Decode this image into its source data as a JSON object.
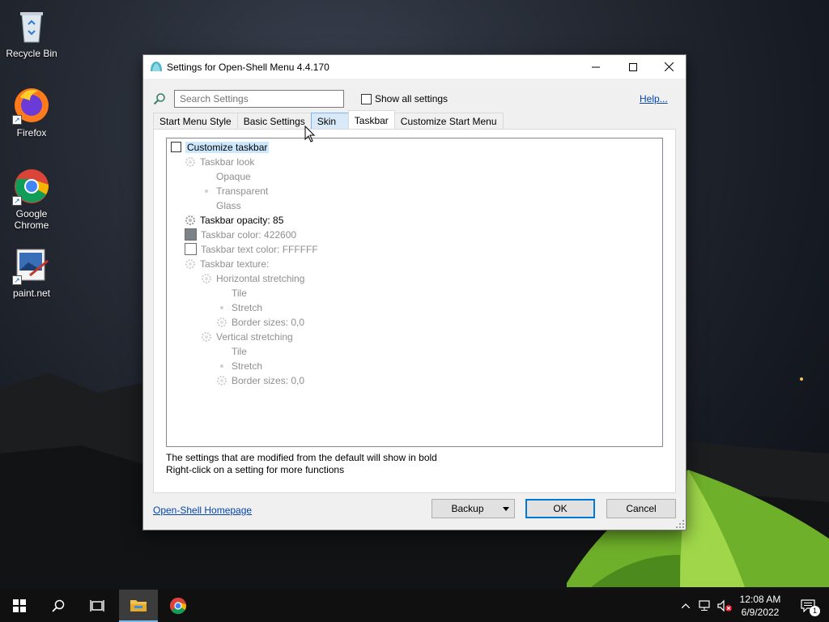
{
  "desktop": {
    "icons": [
      {
        "label": "Recycle Bin",
        "icon": "recycle-bin-icon"
      },
      {
        "label": "Firefox",
        "icon": "firefox-icon"
      },
      {
        "label": "Google Chrome",
        "icon": "chrome-icon"
      },
      {
        "label": "paint.net",
        "icon": "paintnet-icon"
      }
    ]
  },
  "window": {
    "title": "Settings for Open-Shell Menu 4.4.170",
    "search_placeholder": "Search Settings",
    "show_all_label": "Show all settings",
    "help_label": "Help...",
    "tabs": [
      {
        "label": "Start Menu Style",
        "state": "normal"
      },
      {
        "label": "Basic Settings",
        "state": "normal"
      },
      {
        "label": "Skin",
        "state": "hover"
      },
      {
        "label": "Taskbar",
        "state": "active"
      },
      {
        "label": "Customize Start Menu",
        "state": "normal"
      }
    ],
    "tree": [
      {
        "label": "Customize taskbar",
        "kind": "checkbox",
        "checked": false,
        "selected": true
      },
      {
        "label": "Taskbar look",
        "kind": "gear",
        "disabled": true
      },
      {
        "label": "Opaque",
        "kind": "none",
        "disabled": true
      },
      {
        "label": "Transparent",
        "kind": "radio-dot",
        "disabled": true
      },
      {
        "label": "Glass",
        "kind": "none",
        "disabled": true
      },
      {
        "label": "Taskbar opacity: 85",
        "kind": "gear",
        "bold": true
      },
      {
        "label": "Taskbar color: 422600",
        "kind": "swatch",
        "swatch_color": "#7b8288",
        "disabled": true
      },
      {
        "label": "Taskbar text color: FFFFFF",
        "kind": "swatch",
        "swatch_color": "#FFFFFF",
        "disabled": true
      },
      {
        "label": "Taskbar texture:",
        "kind": "gear",
        "disabled": true
      },
      {
        "label": "Horizontal stretching",
        "kind": "gear",
        "disabled": true
      },
      {
        "label": "Tile",
        "kind": "none",
        "disabled": true
      },
      {
        "label": "Stretch",
        "kind": "radio-dot",
        "disabled": true
      },
      {
        "label": "Border sizes: 0,0",
        "kind": "gear",
        "disabled": true
      },
      {
        "label": "Vertical stretching",
        "kind": "gear",
        "disabled": true
      },
      {
        "label": "Tile",
        "kind": "none",
        "disabled": true
      },
      {
        "label": "Stretch",
        "kind": "radio-dot",
        "disabled": true
      },
      {
        "label": "Border sizes: 0,0",
        "kind": "gear",
        "disabled": true
      }
    ],
    "hint_line1": "The settings that are modified from the default will show in bold",
    "hint_line2": "Right-click on a setting for more functions",
    "homepage_label": "Open-Shell Homepage",
    "backup_label": "Backup",
    "ok_label": "OK",
    "cancel_label": "Cancel"
  },
  "taskbar": {
    "time": "12:08 AM",
    "date": "6/9/2022",
    "notification_count": "1",
    "accent": "#76b9ed"
  }
}
